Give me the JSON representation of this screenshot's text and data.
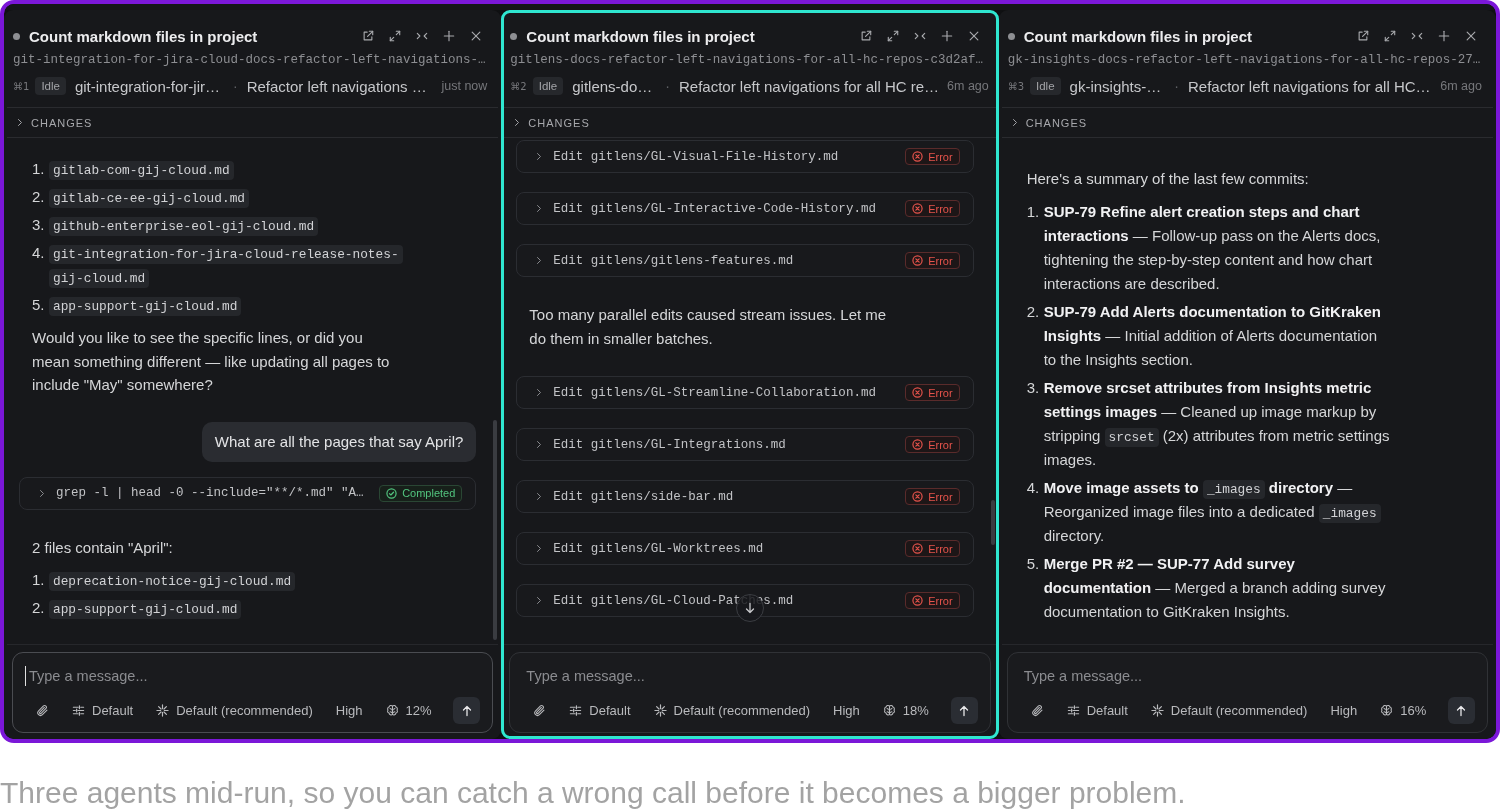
{
  "panes": [
    {
      "selected": false,
      "title": "Count markdown files in project",
      "branch": "git-integration-for-jira-cloud-docs-refactor-left-navigations-…",
      "shortcut": "⌘1",
      "status": "Idle",
      "branch_short": "git-integration-for-jir…",
      "separator": "·",
      "task": "Refactor left navigations …",
      "time": "just now",
      "changes": {
        "label": "CHANGES",
        "expanded": false
      },
      "messages": [
        {
          "kind": "list",
          "items": [
            {
              "number": "1.",
              "parts": [
                {
                  "kind": "code",
                  "text": "gitlab-com-gij-cloud.md"
                }
              ]
            },
            {
              "number": "2.",
              "parts": [
                {
                  "kind": "code",
                  "text": "gitlab-ce-ee-gij-cloud.md"
                }
              ]
            },
            {
              "number": "3.",
              "parts": [
                {
                  "kind": "code",
                  "text": "github-enterprise-eol-gij-cloud.md"
                }
              ]
            },
            {
              "number": "4.",
              "parts": [
                {
                  "kind": "code",
                  "text": "git-integration-for-jira-cloud-release-notes-gij-cloud.md"
                }
              ]
            },
            {
              "number": "5.",
              "parts": [
                {
                  "kind": "code",
                  "text": "app-support-gij-cloud.md"
                }
              ]
            }
          ]
        },
        {
          "kind": "paragraph",
          "text": "Would you like to see the specific lines, or did you mean something different — like updating all pages to include \"May\" somewhere?"
        },
        {
          "kind": "user",
          "text": "What are all the pages that say April?"
        },
        {
          "kind": "tool",
          "command": "grep -l | head -0 --include=\"**/*.md\" \"A…",
          "status": "Completed",
          "failed": false,
          "expanded": false
        },
        {
          "kind": "paragraph",
          "text": "2 files contain \"April\":"
        },
        {
          "kind": "list",
          "items": [
            {
              "number": "1.",
              "parts": [
                {
                  "kind": "code",
                  "text": "deprecation-notice-gij-cloud.md"
                }
              ]
            },
            {
              "number": "2.",
              "parts": [
                {
                  "kind": "code",
                  "text": "app-support-gij-cloud.md"
                }
              ]
            }
          ]
        }
      ],
      "scroll_to_bottom": false,
      "composer": {
        "placeholder": "Type a message...",
        "focused": true,
        "mode": "Default",
        "model": "Default (recommended)",
        "effort": "High",
        "context": "12%"
      }
    },
    {
      "selected": true,
      "title": "Count markdown files in project",
      "branch": "gitlens-docs-refactor-left-navigations-for-all-hc-repos-c3d2af…",
      "shortcut": "⌘2",
      "status": "Idle",
      "branch_short": "gitlens-do…",
      "separator": "·",
      "task": "Refactor left navigations for all HC re…",
      "time": "6m ago",
      "changes": {
        "label": "CHANGES",
        "expanded": false
      },
      "messages": [
        {
          "kind": "tool",
          "command": "Edit gitlens/GL-Visual-File-History.md",
          "status": "Error",
          "failed": true,
          "expanded": false
        },
        {
          "kind": "tool",
          "command": "Edit gitlens/GL-Interactive-Code-History.md",
          "status": "Error",
          "failed": true,
          "expanded": false
        },
        {
          "kind": "tool",
          "command": "Edit gitlens/gitlens-features.md",
          "status": "Error",
          "failed": true,
          "expanded": false
        },
        {
          "kind": "paragraph",
          "text": "Too many parallel edits caused stream issues. Let me do them in smaller batches."
        },
        {
          "kind": "tool",
          "command": "Edit gitlens/GL-Streamline-Collaboration.md",
          "status": "Error",
          "failed": true,
          "expanded": false
        },
        {
          "kind": "tool",
          "command": "Edit gitlens/GL-Integrations.md",
          "status": "Error",
          "failed": true,
          "expanded": false
        },
        {
          "kind": "tool",
          "command": "Edit gitlens/side-bar.md",
          "status": "Error",
          "failed": true,
          "expanded": false
        },
        {
          "kind": "tool",
          "command": "Edit gitlens/GL-Worktrees.md",
          "status": "Error",
          "failed": true,
          "expanded": false
        },
        {
          "kind": "tool",
          "command": "Edit gitlens/GL-Cloud-Patches.md",
          "status": "Error",
          "failed": true,
          "expanded": false
        }
      ],
      "scroll_to_bottom": true,
      "composer": {
        "placeholder": "Type a message...",
        "focused": false,
        "mode": "Default",
        "model": "Default (recommended)",
        "effort": "High",
        "context": "18%"
      }
    },
    {
      "selected": false,
      "title": "Count markdown files in project",
      "branch": "gk-insights-docs-refactor-left-navigations-for-all-hc-repos-27…",
      "shortcut": "⌘3",
      "status": "Idle",
      "branch_short": "gk-insights-…",
      "separator": "·",
      "task": "Refactor left navigations for all HC…",
      "time": "6m ago",
      "changes": {
        "label": "CHANGES",
        "expanded": false
      },
      "messages": [
        {
          "kind": "paragraph",
          "text": "Here's a summary of the last few commits:"
        },
        {
          "kind": "list",
          "items": [
            {
              "number": "1.",
              "parts": [
                {
                  "kind": "text",
                  "text": "**SUP-79 Refine alert creation steps and chart interactions** — Follow-up pass on the Alerts docs, tightening the step-by-step content and how chart interactions are described."
                }
              ]
            },
            {
              "number": "2.",
              "parts": [
                {
                  "kind": "text",
                  "text": "**SUP-79 Add Alerts documentation to GitKraken Insights** — Initial addition of Alerts documentation to the Insights section."
                }
              ]
            },
            {
              "number": "3.",
              "parts": [
                {
                  "kind": "text",
                  "text": "**Remove srcset attributes from Insights metric settings images** — Cleaned up image markup by stripping "
                },
                {
                  "kind": "code",
                  "text": "srcset"
                },
                {
                  "kind": "text",
                  "text": " (2x) attributes from metric settings images."
                }
              ]
            },
            {
              "number": "4.",
              "parts": [
                {
                  "kind": "text",
                  "text": "**Move image assets to** "
                },
                {
                  "kind": "code",
                  "text": "_images"
                },
                {
                  "kind": "text",
                  "text": " **directory** — Reorganized image files into a dedicated "
                },
                {
                  "kind": "code",
                  "text": "_images"
                },
                {
                  "kind": "text",
                  "text": " directory."
                }
              ]
            },
            {
              "number": "5.",
              "parts": [
                {
                  "kind": "text",
                  "text": "**Merge PR #2 — SUP-77 Add survey documentation** — Merged a branch adding survey documentation to GitKraken Insights."
                }
              ]
            }
          ]
        }
      ],
      "scroll_to_bottom": false,
      "composer": {
        "placeholder": "Type a message...",
        "focused": false,
        "mode": "Default",
        "model": "Default (recommended)",
        "effort": "High",
        "context": "16%"
      }
    }
  ],
  "caption": "Three agents mid-run, so you can catch a wrong call before it becomes a bigger problem."
}
